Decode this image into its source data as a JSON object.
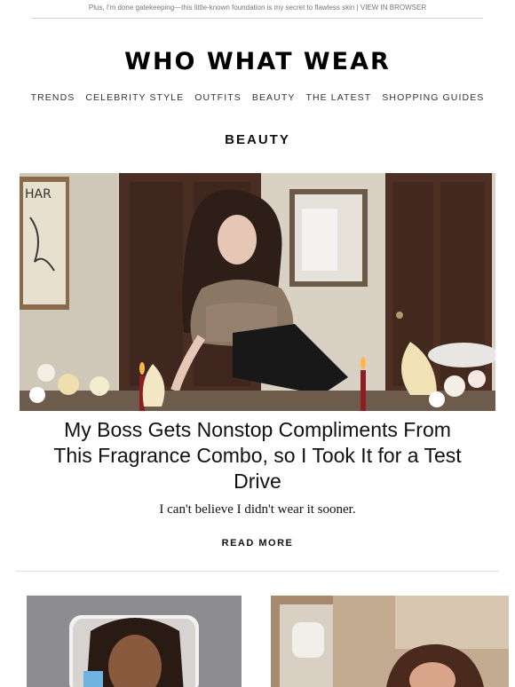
{
  "preheader": {
    "text": "Plus, I'm done gatekeeping—this little-known foundation is my secret to flawless skin | ",
    "view_in_browser": "VIEW IN BROWSER"
  },
  "brand": {
    "logo": "WHO WHAT WEAR"
  },
  "nav": {
    "items": [
      "TRENDS",
      "CELEBRITY STYLE",
      "OUTFITS",
      "BEAUTY",
      "THE LATEST",
      "SHOPPING GUIDES"
    ]
  },
  "section": {
    "title": "BEAUTY"
  },
  "feature": {
    "image_alt": "woman in a fur stole leaning over a candlelit table with flowers",
    "headline": "My Boss Gets Nonstop Compliments From This Fragrance Combo, so I Took It for a Test Drive",
    "dek": "I can't believe I didn't wear it sooner.",
    "cta": "READ MORE"
  },
  "thumbnails": [
    {
      "image_alt": "woman with braids holding a blue skincare tube"
    },
    {
      "image_alt": "woman with slicked-back hair in a bathroom"
    }
  ]
}
